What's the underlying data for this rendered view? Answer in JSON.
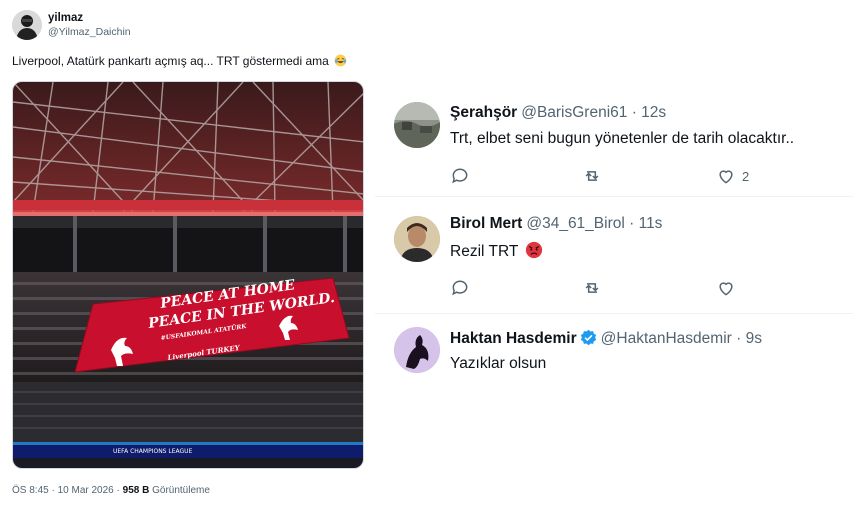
{
  "main_tweet": {
    "display_name": "yilmaz",
    "handle": "@Yilmaz_Daichin",
    "text": "Liverpool, Atatürk pankartı açmış aq... TRT göstermedi ama",
    "emoji": "face-with-tears-of-joy",
    "image": {
      "banner_text_line1": "PEACE AT HOME",
      "banner_text_line2": "PEACE IN THE WORLD.",
      "banner_text_line3": "#USFAIKOMAL ATATÜRK",
      "banner_corner_text": "Liverpool TURKEY",
      "board_text": "UEFA CHAMPIONS LEAGUE"
    },
    "meta": {
      "time": "ÖS 8:45",
      "separator": " · ",
      "date": "10 Mar 2026",
      "views_count": "958 B",
      "views_label": "Görüntüleme"
    }
  },
  "replies": [
    {
      "name": "Şerahşör",
      "handle": "@BarisGreni61",
      "time": "· 12s",
      "text": "Trt, elbet seni bugun yönetenler de tarih olacaktır..",
      "likes": "2",
      "avatar": "ruined-landscape-avatar"
    },
    {
      "name": "Birol Mert",
      "handle": "@34_61_Birol",
      "time": "· 11s",
      "text": "Rezil TRT",
      "emoji": "angry-face",
      "likes": "",
      "avatar": "man-portrait-avatar"
    },
    {
      "name": "Haktan Hasdemir",
      "handle": "@HaktanHasdemir",
      "time": "· 9s",
      "text": "Yazıklar olsun",
      "verified": true,
      "avatar": "horse-silhouette-avatar"
    }
  ],
  "colors": {
    "text_primary": "#0f1419",
    "text_secondary": "#536471",
    "verified_blue": "#1d9bf0",
    "banner_red": "#c8102e",
    "divider": "#eff3f4"
  }
}
